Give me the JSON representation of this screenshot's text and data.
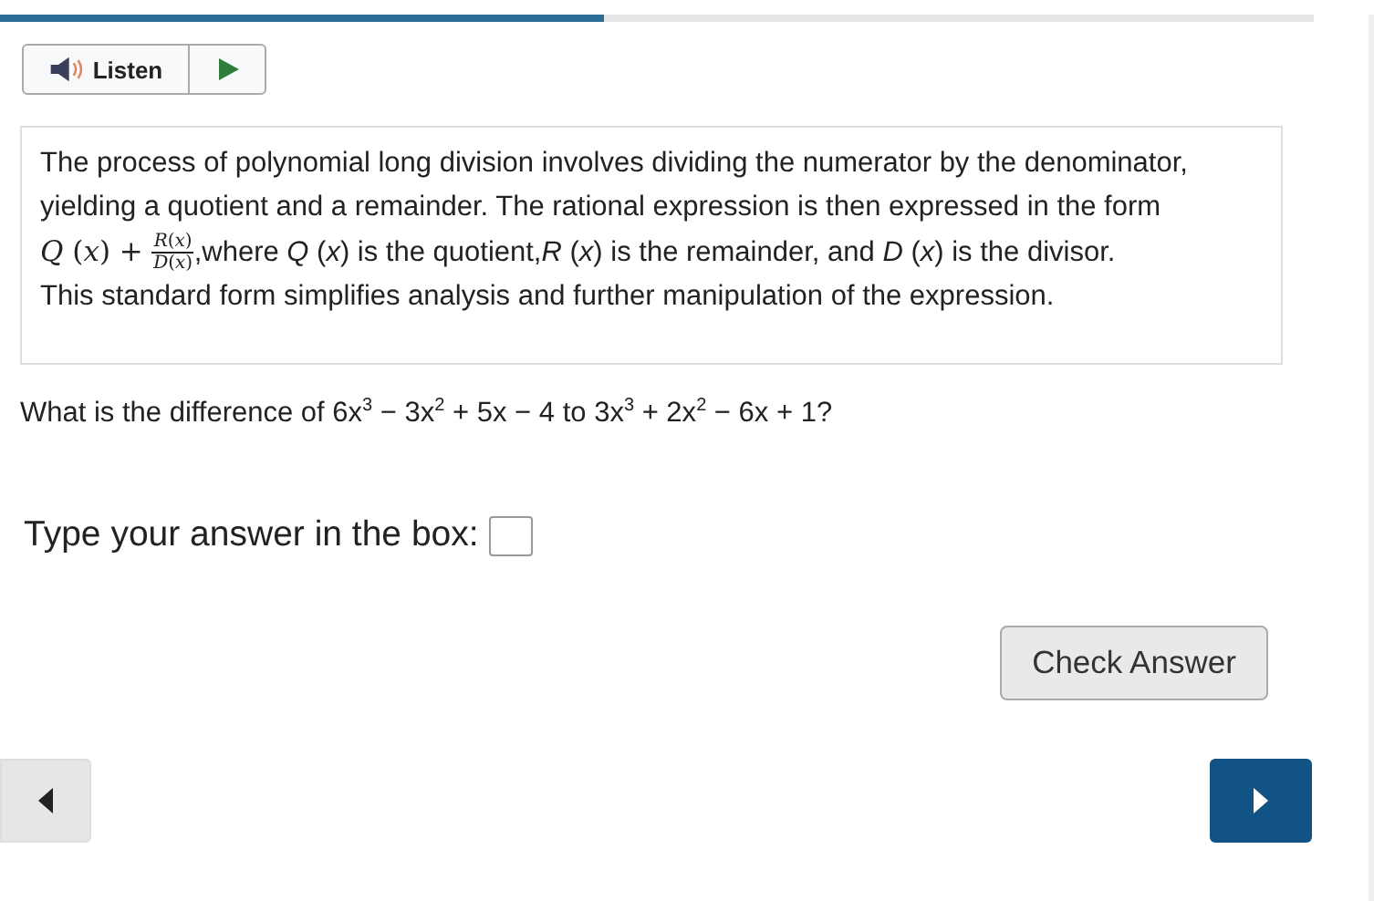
{
  "progress": {
    "level": 0.46
  },
  "listen": {
    "label": "Listen"
  },
  "passage": {
    "intro": "The process of polynomial long division involves dividing the numerator by the denominator, yielding a quotient and a remainder. The rational expression is then expressed in the form",
    "lead": "*Q* (*x*) +",
    "numerator": "*R*(*x*)",
    "denominator": "*D*(*x*)",
    "rest": ",where *Q* (*x*) is the quotient,*R* (*x*) is the remainder, and *D* (*x*) is the divisor.",
    "closing": "This standard form simplifies analysis and further manipulation of the expression."
  },
  "question": "What is the difference of 6x$^{3}$ − 3x$^{2}$ + 5x − 4 to 3x$^{3}$ + 2x$^{2}$ − 6x + 1?",
  "answer": {
    "label": "Type your answer in the box:"
  },
  "check_button": "Check Answer"
}
